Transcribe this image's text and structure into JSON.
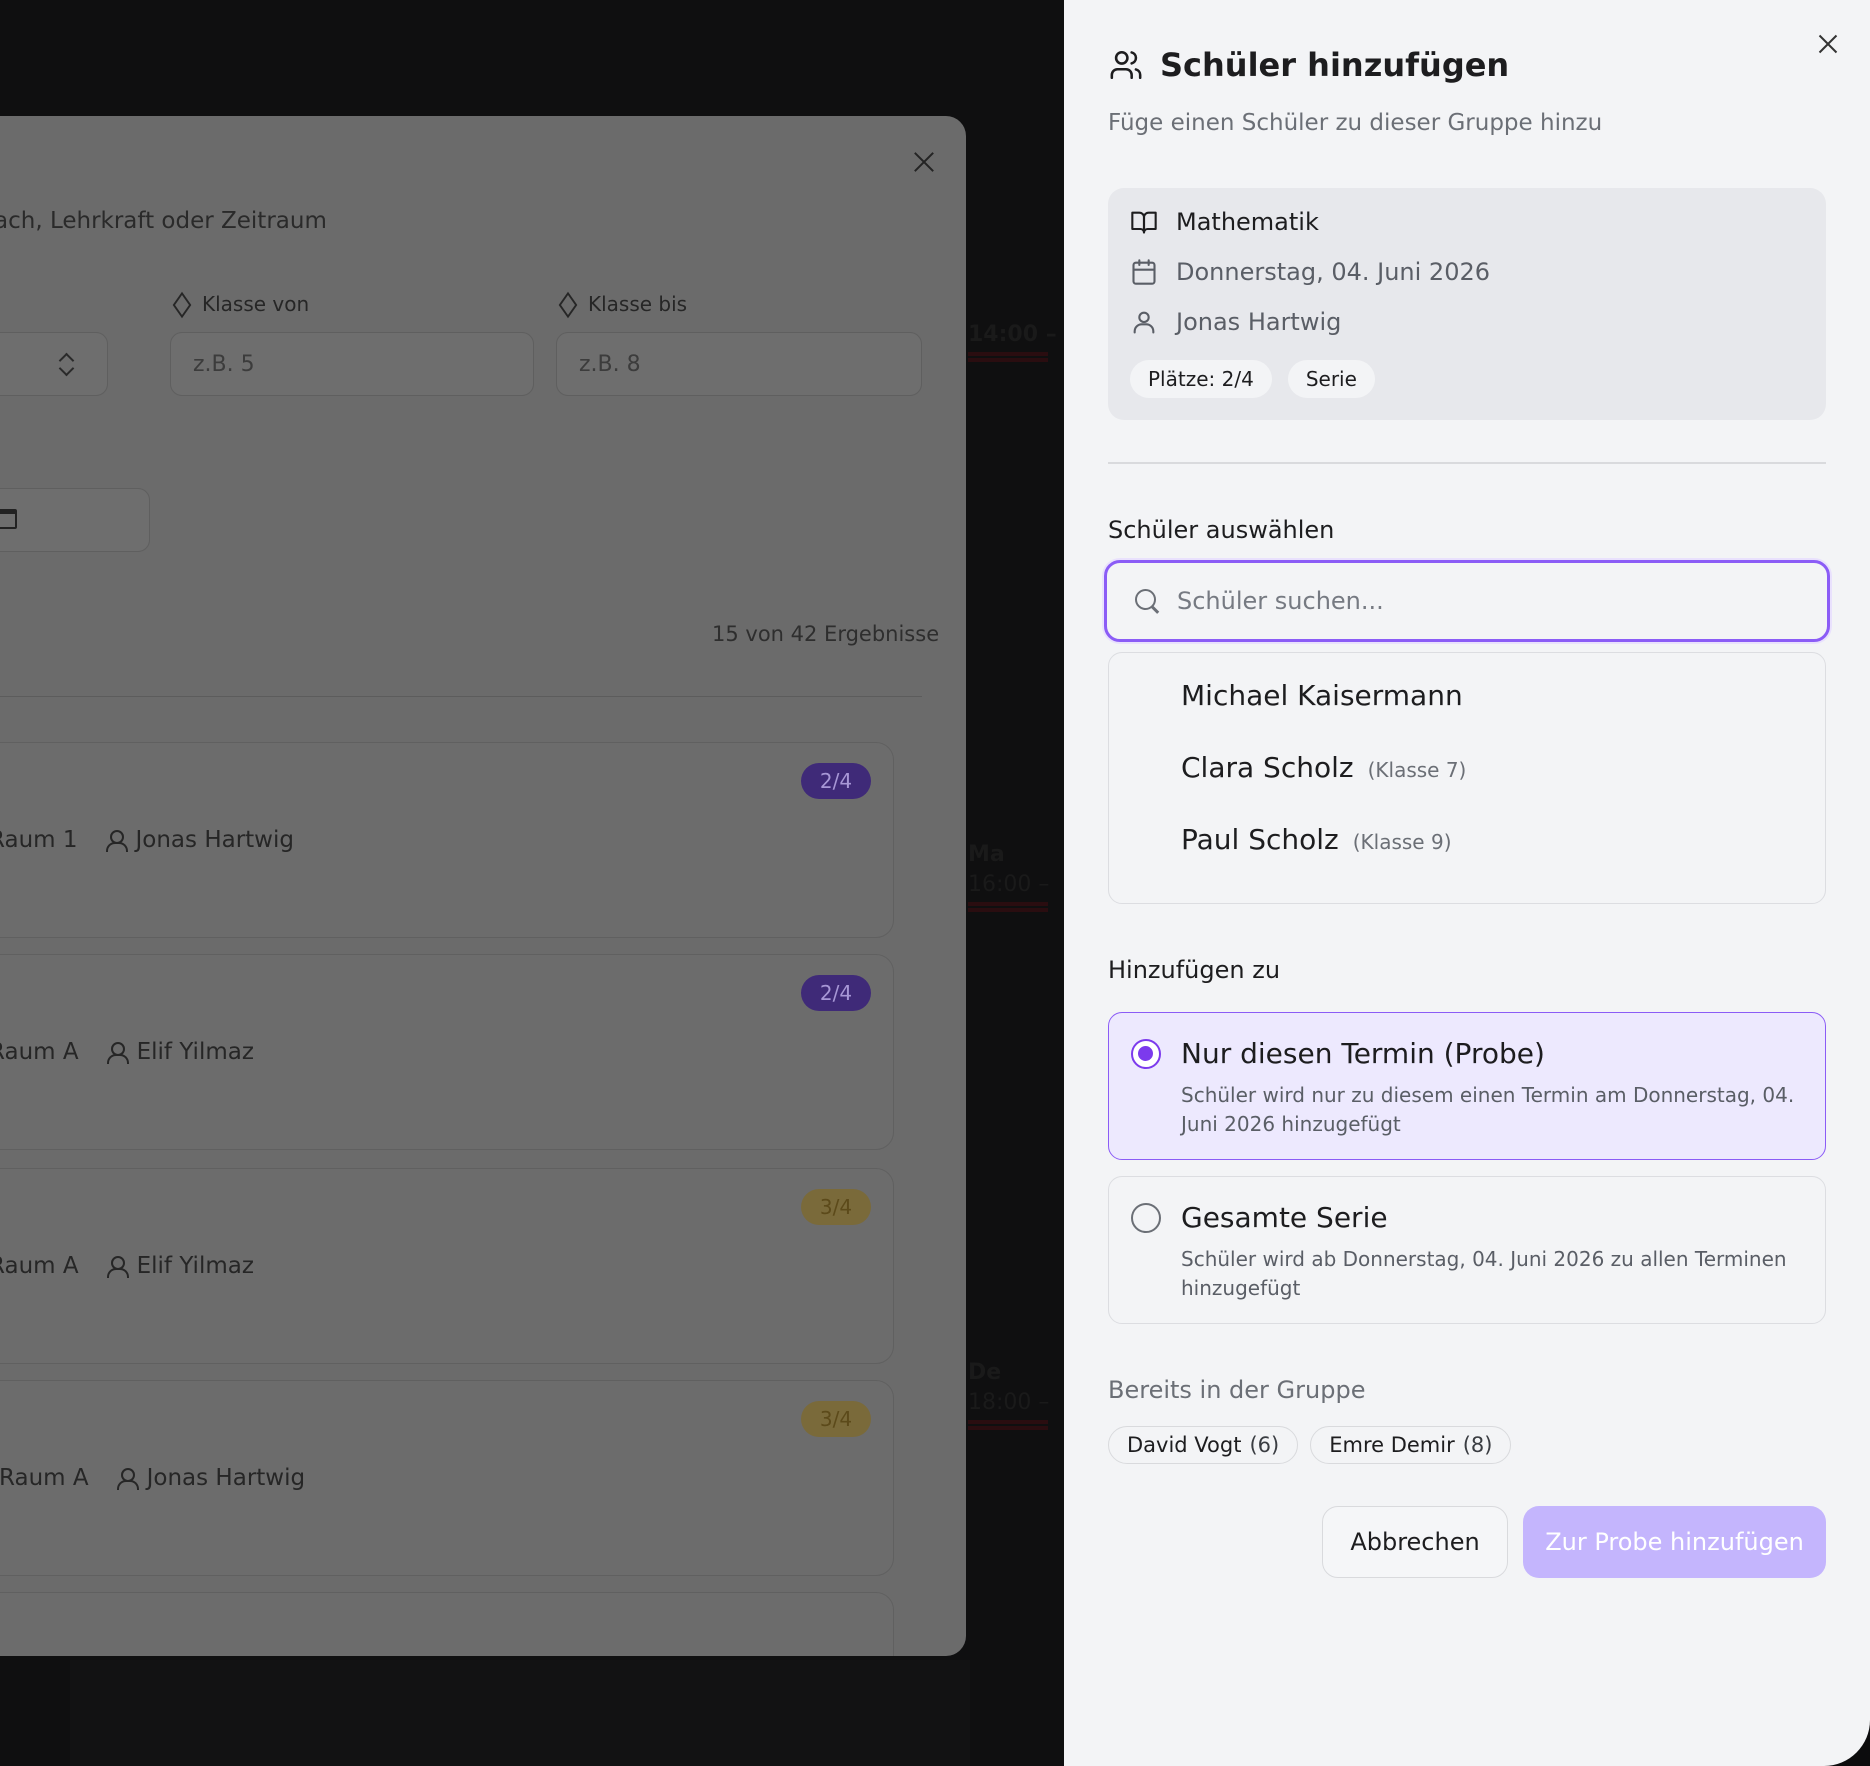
{
  "background_modal": {
    "subtitle": "ach, Lehrkraft oder Zeitraum",
    "filters": {
      "class_from_label": "Klasse von",
      "class_from_placeholder": "z.B. 5",
      "class_to_label": "Klasse bis",
      "class_to_placeholder": "z.B. 8"
    },
    "results_count": "15 von 42 Ergebnisse",
    "cards": [
      {
        "badge": "2/4",
        "room": "Raum 1",
        "teacher": "Jonas Hartwig"
      },
      {
        "badge": "2/4",
        "room": "Raum A",
        "teacher": "Elif Yilmaz"
      },
      {
        "badge": "3/4",
        "room": "Raum A",
        "teacher": "Elif Yilmaz"
      },
      {
        "badge": "3/4",
        "room": "Raum A",
        "teacher": "Jonas Hartwig"
      }
    ]
  },
  "panel": {
    "title": "Schüler hinzufügen",
    "subtitle": "Füge einen Schüler zu dieser Gruppe hinzu",
    "info": {
      "subject": "Mathematik",
      "date": "Donnerstag, 04. Juni 2026",
      "teacher": "Jonas Hartwig",
      "seats": "Plätze: 2/4",
      "type": "Serie"
    },
    "select_label": "Schüler auswählen",
    "search": {
      "placeholder": "Schüler suchen...",
      "value": ""
    },
    "dropdown_items": [
      {
        "name": "Michael Kaisermann",
        "class": ""
      },
      {
        "name": "Clara Scholz",
        "class": "(Klasse 7)"
      },
      {
        "name": "Paul Scholz",
        "class": "(Klasse 9)"
      }
    ],
    "add_to_label": "Hinzufügen zu",
    "options": [
      {
        "title": "Nur diesen Termin (Probe)",
        "description": "Schüler wird nur zu diesem einen Termin am Donnerstag, 04. Juni 2026 hinzugefügt",
        "selected": true
      },
      {
        "title": "Gesamte Serie",
        "description": "Schüler wird ab Donnerstag, 04. Juni 2026 zu allen Terminen hinzugefügt",
        "selected": false
      }
    ],
    "already_label": "Bereits in der Gruppe",
    "members": [
      {
        "name": "David Vogt",
        "class": "(6)"
      },
      {
        "name": "Emre Demir",
        "class": "(8)"
      }
    ],
    "buttons": {
      "cancel": "Abbrechen",
      "submit": "Zur Probe hinzufügen"
    }
  },
  "colors": {
    "accent": "#8b5cf6",
    "accent_light": "#ede9fe",
    "submit_disabled": "#c4b5fd",
    "panel_bg": "#f3f4f6"
  },
  "icons": {
    "title": "users-icon",
    "subject": "book-open-icon",
    "date": "calendar-icon",
    "teacher": "user-icon",
    "search": "search-icon",
    "close": "close-icon"
  }
}
